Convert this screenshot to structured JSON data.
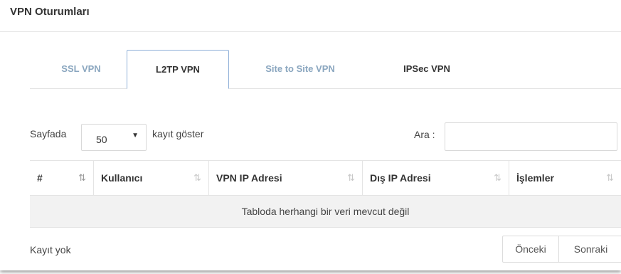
{
  "panel": {
    "title": "VPN Oturumları"
  },
  "tabs": [
    {
      "label": "SSL VPN",
      "active": false
    },
    {
      "label": "L2TP VPN",
      "active": true
    },
    {
      "label": "Site to Site VPN",
      "active": false
    },
    {
      "label": "IPSec VPN",
      "active": false
    }
  ],
  "length_control": {
    "prefix": "Sayfada",
    "selected": "50",
    "suffix": "kayıt göster"
  },
  "search": {
    "label": "Ara :",
    "value": "",
    "placeholder": ""
  },
  "table": {
    "columns": [
      {
        "label": "#",
        "sort": "asc"
      },
      {
        "label": "Kullanıcı",
        "sort": "none"
      },
      {
        "label": "VPN IP Adresi",
        "sort": "none"
      },
      {
        "label": "Dış IP Adresi",
        "sort": "none"
      },
      {
        "label": "İşlemler",
        "sort": "none"
      }
    ],
    "empty_message": "Tabloda herhangi bir veri mevcut değil"
  },
  "footer": {
    "info": "Kayıt yok",
    "prev": "Önceki",
    "next": "Sonraki"
  },
  "icons": {
    "sort_asc": "sort-amount-asc-icon",
    "sort_none": "sort-both-icon",
    "select_caret": "caret-down-icon"
  }
}
